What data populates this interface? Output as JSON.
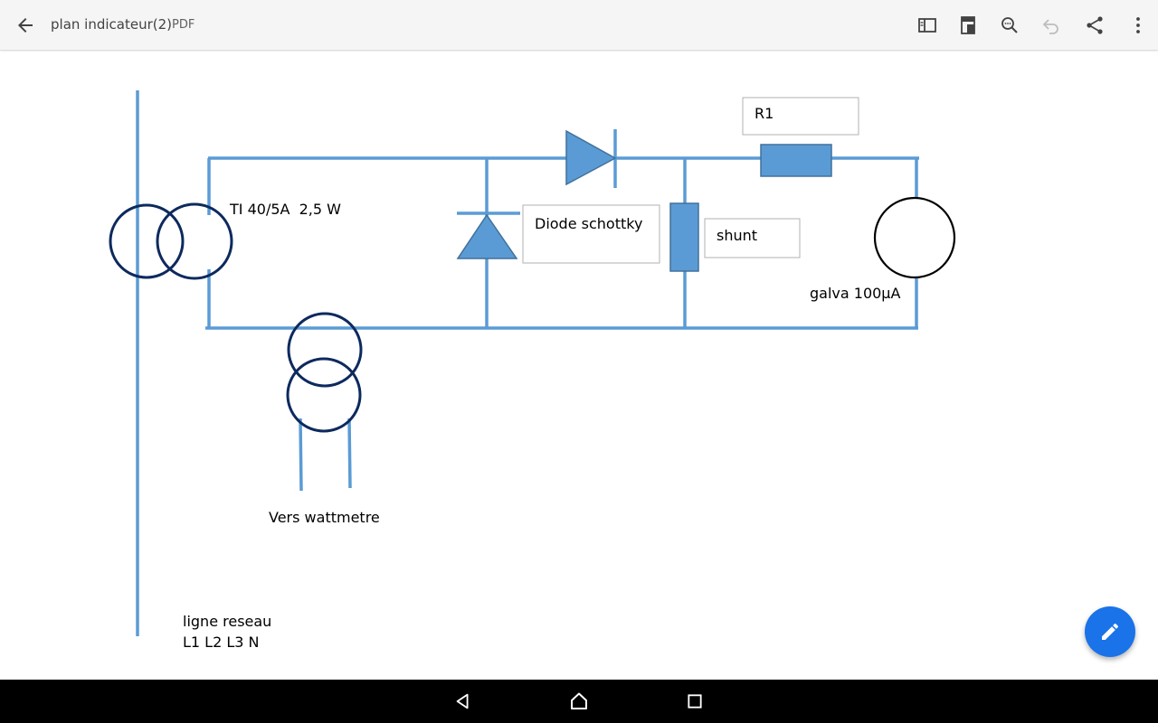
{
  "app_bar": {
    "title": "plan indicateur(2)",
    "file_type": "PDF",
    "icons": [
      "back-arrow-icon",
      "reading-mode-icon",
      "page-layout-icon",
      "search-icon",
      "undo-icon",
      "share-icon",
      "more-vert-icon"
    ]
  },
  "diagram": {
    "ti_label": "TI 40/5A  2,5 W",
    "diode_label": "Diode schottky",
    "shunt_label": "shunt",
    "r1_label": "R1",
    "galva_label": "galva 100µA",
    "wattmeter_label": "Vers wattmetre",
    "line_label_1": "ligne reseau",
    "line_label_2": "L1 L2 L3 N"
  },
  "fab": {
    "icon": "edit-pencil-icon"
  },
  "nav_bar": {
    "icons": [
      "back-triangle-icon",
      "home-icon",
      "recents-square-icon"
    ]
  },
  "colors": {
    "wire": "#5b9bd5",
    "component_fill": "#5b9bd5",
    "component_stroke": "#41719c",
    "transformer_stroke": "#0d2a5e",
    "fab": "#1a73e8"
  }
}
